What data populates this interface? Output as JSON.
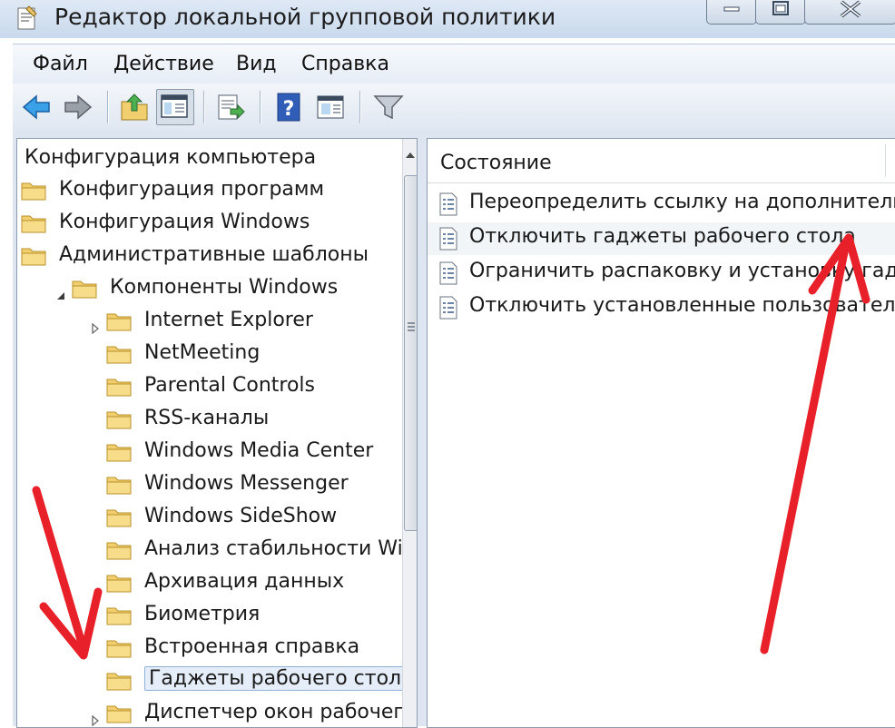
{
  "window": {
    "title": "Редактор локальной групповой политики"
  },
  "menu": {
    "items": [
      "Файл",
      "Действие",
      "Вид",
      "Справка"
    ]
  },
  "toolbar": {
    "buttons": [
      "back-icon",
      "forward-icon",
      "up-folder-icon",
      "show-hide-tree-icon",
      "export-list-icon",
      "help-icon",
      "properties-icon",
      "filter-icon"
    ]
  },
  "tree": {
    "root": "Конфигурация компьютера",
    "items": [
      {
        "label": "Конфигурация программ",
        "level": 1,
        "expander": ""
      },
      {
        "label": "Конфигурация Windows",
        "level": 1,
        "expander": ""
      },
      {
        "label": "Административные шаблоны",
        "level": 1,
        "expander": ""
      },
      {
        "label": "Компоненты Windows",
        "level": 2,
        "expander": "expanded"
      },
      {
        "label": "Internet Explorer",
        "level": 3,
        "expander": "collapsed"
      },
      {
        "label": "NetMeeting",
        "level": 3,
        "expander": ""
      },
      {
        "label": "Parental Controls",
        "level": 3,
        "expander": ""
      },
      {
        "label": "RSS-каналы",
        "level": 3,
        "expander": ""
      },
      {
        "label": "Windows Media Center",
        "level": 3,
        "expander": ""
      },
      {
        "label": "Windows Messenger",
        "level": 3,
        "expander": ""
      },
      {
        "label": "Windows SideShow",
        "level": 3,
        "expander": ""
      },
      {
        "label": "Анализ стабильности Win",
        "level": 3,
        "expander": ""
      },
      {
        "label": "Архивация данных",
        "level": 3,
        "expander": ""
      },
      {
        "label": "Биометрия",
        "level": 3,
        "expander": ""
      },
      {
        "label": "Встроенная справка",
        "level": 3,
        "expander": ""
      },
      {
        "label": "Гаджеты рабочего стола",
        "level": 3,
        "expander": "",
        "selected": true
      },
      {
        "label": "Диспетчер окон рабочего",
        "level": 3,
        "expander": "collapsed"
      }
    ]
  },
  "list": {
    "column_header": "Состояние",
    "rows": [
      {
        "label": "Переопределить ссылку на дополнительн"
      },
      {
        "label": "Отключить гаджеты рабочего стола",
        "hover": true
      },
      {
        "label": "Ограничить распаковку и установку гадж"
      },
      {
        "label": "Отключить установленные пользователем"
      }
    ]
  },
  "colors": {
    "annotation_arrow": "#e8202a",
    "selection_border": "#8fb0d6",
    "folder": "#f2cf6e"
  }
}
